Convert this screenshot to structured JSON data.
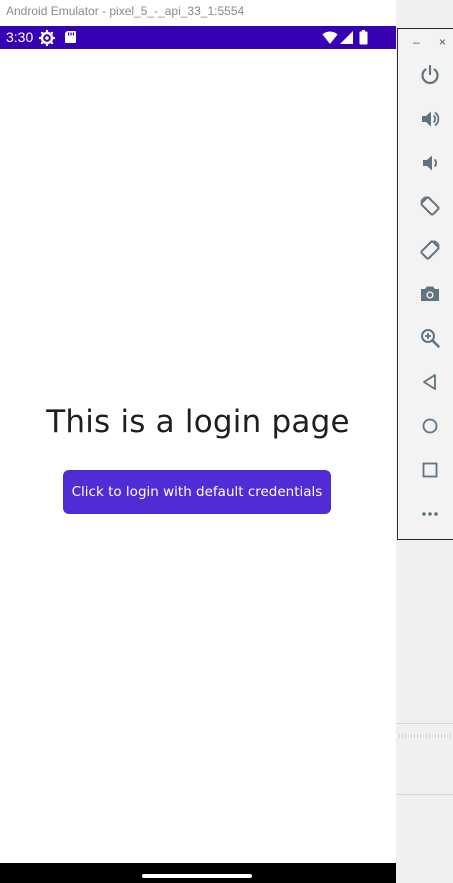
{
  "window": {
    "title": "Android Emulator - pixel_5_-_api_33_1:5554",
    "minimize_label": "–",
    "close_label": "×"
  },
  "statusbar": {
    "time": "3:30",
    "icons": [
      "settings-gear-icon",
      "sd-card-icon",
      "wifi-icon",
      "cell-signal-icon",
      "battery-icon"
    ]
  },
  "main": {
    "title": "This is a login page",
    "login_button_label": "Click to login with default credentials"
  },
  "colors": {
    "statusbar": "#3700b3",
    "button": "#512bd4",
    "toolbar_icon": "#5f7480"
  },
  "emulator_toolbar": {
    "tools": [
      {
        "name": "power-icon"
      },
      {
        "name": "volume-up-icon"
      },
      {
        "name": "volume-down-icon"
      },
      {
        "name": "rotate-left-icon"
      },
      {
        "name": "rotate-right-icon"
      },
      {
        "name": "camera-icon"
      },
      {
        "name": "zoom-icon"
      },
      {
        "name": "back-icon"
      },
      {
        "name": "home-icon"
      },
      {
        "name": "overview-icon"
      },
      {
        "name": "more-icon"
      }
    ]
  }
}
